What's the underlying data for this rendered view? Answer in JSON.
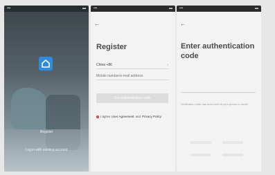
{
  "splash": {
    "logo": "home-icon",
    "register_link": "Register",
    "login_link": "Log in with existing account"
  },
  "register": {
    "title": "Register",
    "country_value": "China +86",
    "account_placeholder": "Mobile number/e-mail address",
    "get_code_label": "Get authentication code",
    "agree_prefix": "I agree",
    "user_agreement": "User Agreement",
    "and_text": "and",
    "privacy_policy": "Privacy Policy"
  },
  "auth": {
    "title": "Enter authentication code",
    "hint": "Verification code has been sent to your phone or email"
  },
  "colors": {
    "logo_blue": "#2f8bdc",
    "checkbox_red": "#d9534f",
    "button_gray": "#dcdcdc"
  }
}
